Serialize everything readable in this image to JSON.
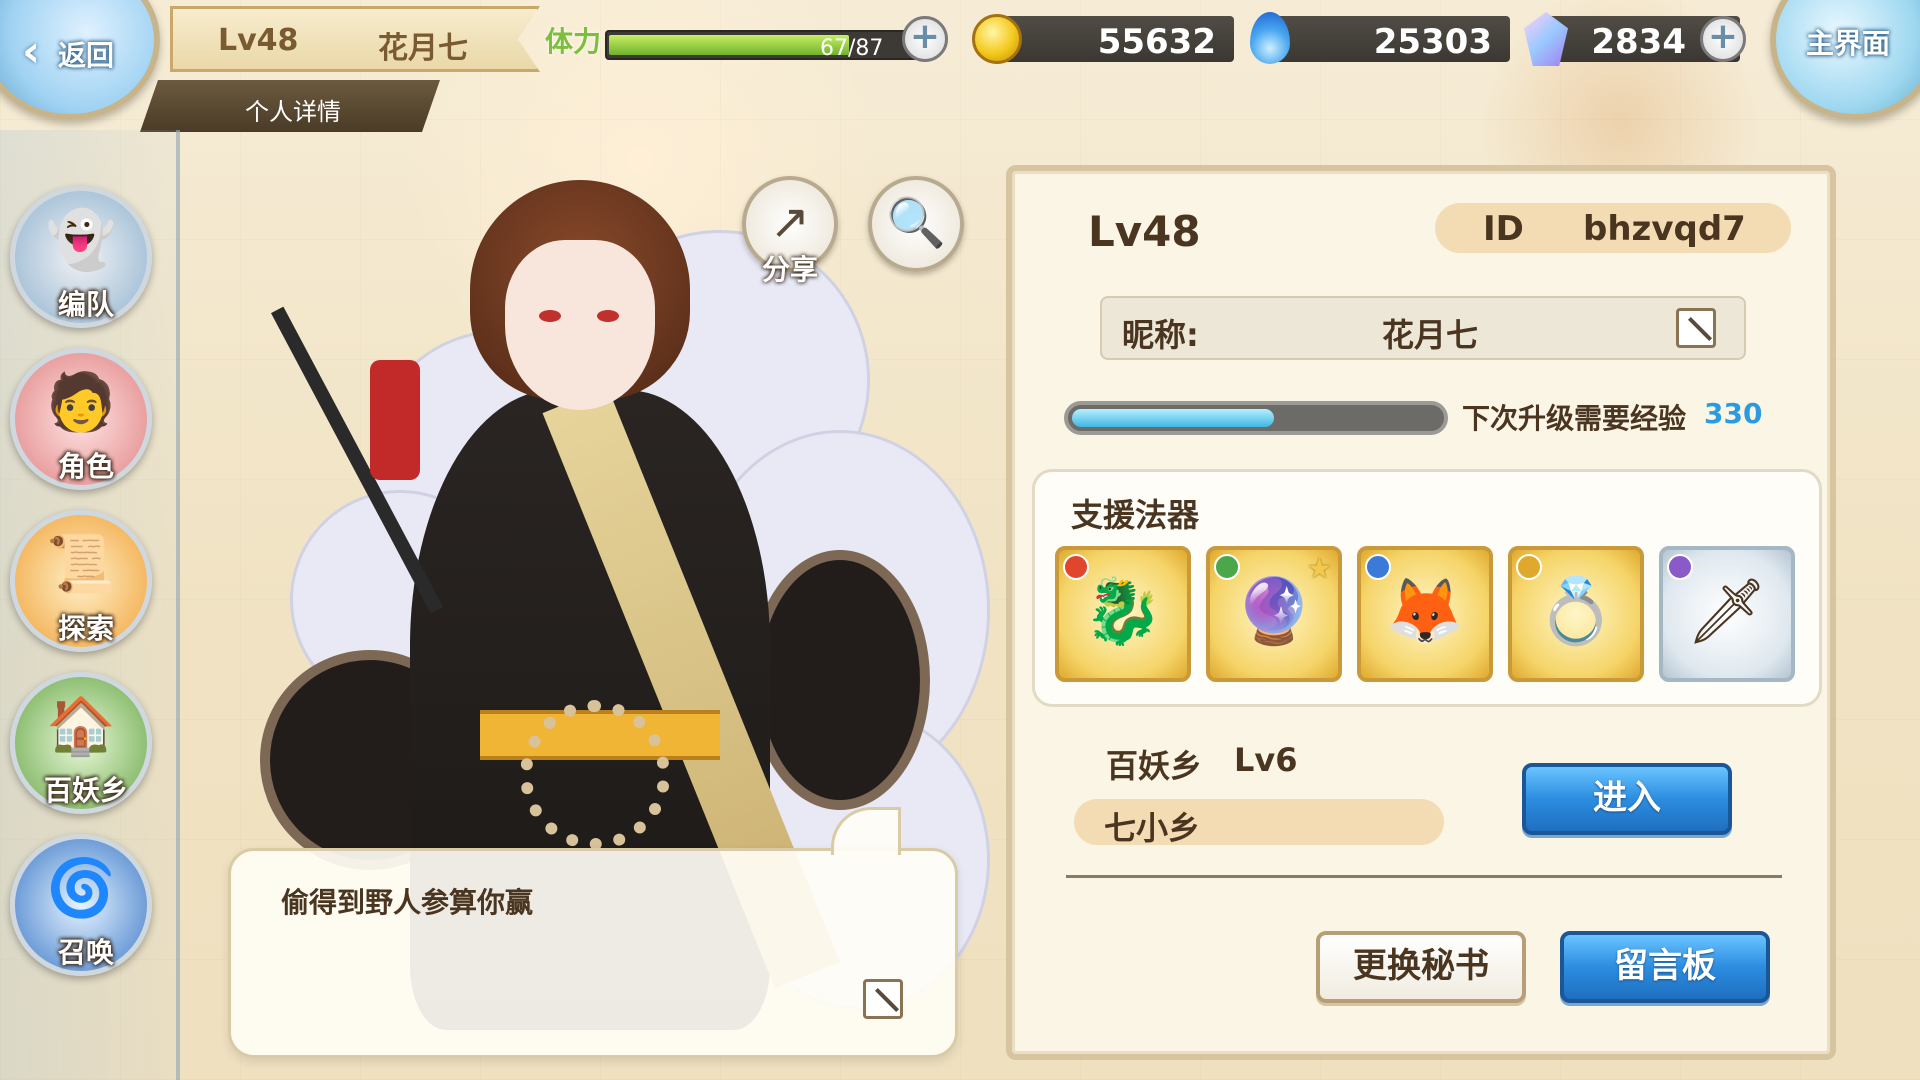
{
  "topbar": {
    "back_label": "返回",
    "player_level": "Lv48",
    "player_name": "花月七",
    "subtitle": "个人详情",
    "stamina_label": "体力",
    "stamina_value": "67/87",
    "stamina_current": 67,
    "stamina_max": 87,
    "gold": "55632",
    "soul_fire": "25303",
    "crystal": "2834",
    "home_label": "主界面"
  },
  "left_nav": {
    "items": [
      {
        "label": "编队",
        "icon": "ghost-icon"
      },
      {
        "label": "角色",
        "icon": "character-icon"
      },
      {
        "label": "探索",
        "icon": "scroll-icon"
      },
      {
        "label": "百妖乡",
        "icon": "house-icon"
      },
      {
        "label": "召唤",
        "icon": "summon-icon"
      }
    ]
  },
  "center": {
    "share_label": "分享",
    "speech_text": "偷得到野人参算你赢"
  },
  "panel": {
    "level": "Lv48",
    "id_label": "ID",
    "id_value": "bhzvqd7",
    "nickname_label": "昵称:",
    "nickname_value": "花月七",
    "exp_label": "下次升级需要经验",
    "exp_value": "330",
    "exp_fraction": 0.55,
    "support_title": "支援法器",
    "artifacts": [
      {
        "icon": "red-dragon-scroll-icon",
        "tier": "gold",
        "badge_color": "#e0452e"
      },
      {
        "icon": "green-orb-ring-icon",
        "tier": "gold",
        "badge_color": "#4aa84a",
        "starred": true
      },
      {
        "icon": "blue-fox-mask-icon",
        "tier": "gold",
        "badge_color": "#3b7ad8"
      },
      {
        "icon": "crystal-ring-icon",
        "tier": "gold",
        "badge_color": "#e0a92e"
      },
      {
        "icon": "red-staff-icon",
        "tier": "silver",
        "badge_color": "#8a5ac8"
      }
    ],
    "village_title": "百妖乡",
    "village_level": "Lv6",
    "village_name": "七小乡",
    "enter_button": "进入",
    "change_secretary_button": "更换秘书",
    "message_board_button": "留言板"
  },
  "colors": {
    "accent_blue": "#2c8de0",
    "exp_value": "#2a9be0",
    "panel_bg": "#fbf5e6",
    "pill": "#f3dcb4"
  }
}
